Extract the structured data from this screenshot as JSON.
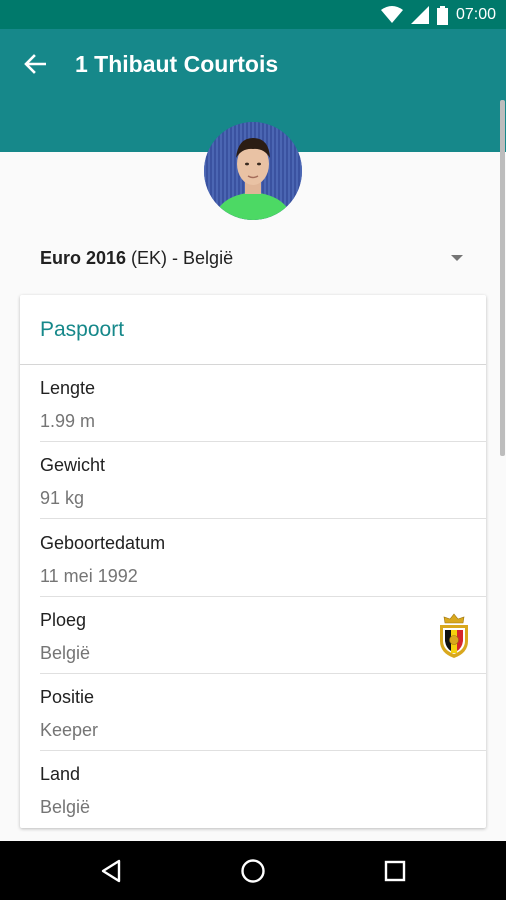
{
  "status_bar": {
    "time": "07:00",
    "icons": [
      "wifi-icon",
      "cell-signal-icon",
      "battery-icon"
    ]
  },
  "app_bar": {
    "title": "1 Thibaut Courtois",
    "back_icon": "arrow-left-icon",
    "color": "#16888a"
  },
  "avatar": {
    "description_icon": "player-avatar"
  },
  "tournament_selector": {
    "bold": "Euro 2016",
    "rest": " (EK) - België",
    "icon": "dropdown-arrow-icon"
  },
  "passport_card": {
    "title": "Paspoort",
    "accent": "#16888a",
    "rows": [
      {
        "label": "Lengte",
        "value": "1.99 m"
      },
      {
        "label": "Gewicht",
        "value": "91 kg"
      },
      {
        "label": "Geboortedatum",
        "value": "11 mei 1992"
      },
      {
        "label": "Ploeg",
        "value": "België",
        "icon": "belgium-crest-icon"
      },
      {
        "label": "Positie",
        "value": "Keeper"
      },
      {
        "label": "Land",
        "value": "België"
      }
    ]
  },
  "nav_bar": {
    "icons": [
      "back-triangle-icon",
      "home-circle-icon",
      "recents-square-icon"
    ]
  }
}
